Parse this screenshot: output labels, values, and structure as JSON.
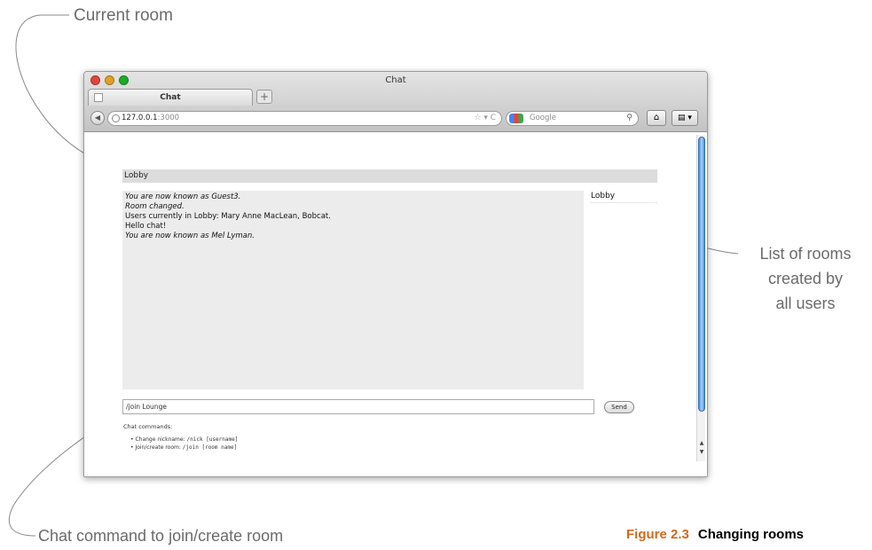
{
  "annotations": {
    "current_room": "Current room",
    "room_list_line1": "List of rooms",
    "room_list_line2": "created by",
    "room_list_line3": "all users",
    "chat_command": "Chat command to join/create room"
  },
  "figure": {
    "number": "Figure 2.3",
    "title": "Changing rooms"
  },
  "browser": {
    "window_title": "Chat",
    "tab_label": "Chat",
    "new_tab_glyph": "+",
    "back_glyph": "◀",
    "url_host": "127.0.0.1",
    "url_port": ":3000",
    "url_tools": "☆ ▾ C",
    "search_placeholder": "Google",
    "search_glyph": "⚲",
    "home_glyph": "⌂",
    "bookmarks_glyph": "▤ ▾"
  },
  "app": {
    "current_room": "Lobby",
    "messages": [
      {
        "text": "You are now known as Guest3.",
        "system": true
      },
      {
        "text": "Room changed.",
        "system": true
      },
      {
        "text": "Users currently in Lobby: Mary Anne MacLean, Bobcat.",
        "system": false
      },
      {
        "text": "Hello chat!",
        "system": false
      },
      {
        "text": "You are now known as Mel Lyman.",
        "system": true
      }
    ],
    "rooms": [
      "Lobby"
    ],
    "input_value": "/join Lounge",
    "send_label": "Send",
    "help_title": "Chat commands:",
    "help_nick_label": "Change nickname: ",
    "help_nick_cmd": "/nick [username]",
    "help_join_label": "Join/create room: ",
    "help_join_cmd": "/join [room name]"
  },
  "colors": {
    "callout_text": "#6b6b6b",
    "figure_number": "#d2691e",
    "room_bar": "#dcdcdc",
    "message_area": "#ececec",
    "scroll_thumb": "#4a8fd9"
  }
}
